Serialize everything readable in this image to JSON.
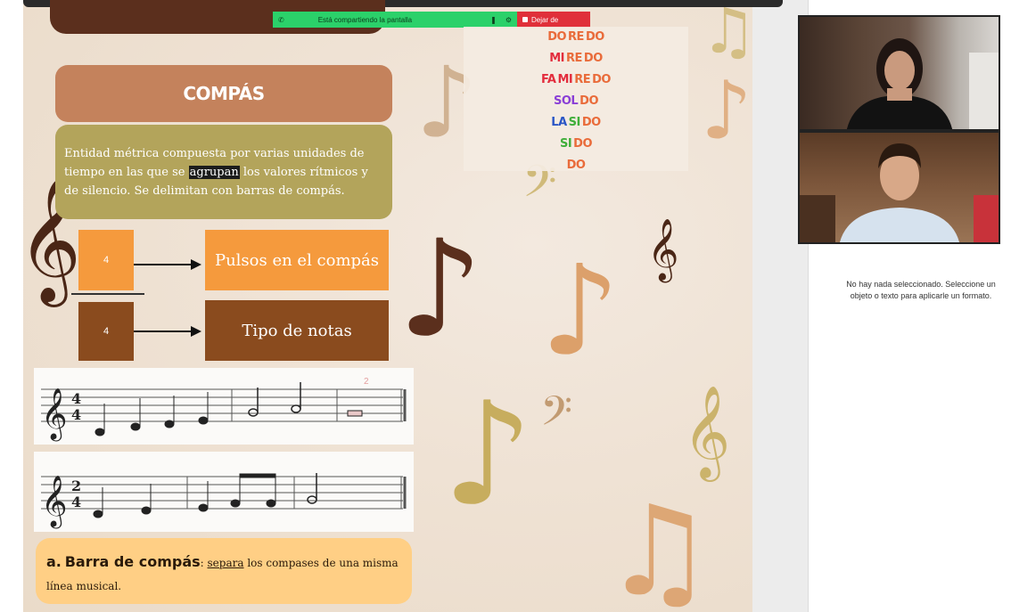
{
  "share_bar": {
    "sharing_label": "Está compartiendo la pantalla",
    "stop_label": "Dejar de"
  },
  "solfege_rows": [
    [
      {
        "t": "DO",
        "c": "#e96b3a"
      },
      {
        "t": "RE",
        "c": "#e96b3a"
      },
      {
        "t": "DO",
        "c": "#e96b3a"
      }
    ],
    [
      {
        "t": "MI",
        "c": "#e32d3d"
      },
      {
        "t": "RE",
        "c": "#e96b3a"
      },
      {
        "t": "DO",
        "c": "#e96b3a"
      }
    ],
    [
      {
        "t": "FA",
        "c": "#e32d3d"
      },
      {
        "t": "MI",
        "c": "#e32d3d"
      },
      {
        "t": "RE",
        "c": "#e96b3a"
      },
      {
        "t": "DO",
        "c": "#e96b3a"
      }
    ],
    [
      {
        "t": "SOL",
        "c": "#8a3fd6"
      },
      {
        "t": "DO",
        "c": "#e96b3a"
      }
    ],
    [
      {
        "t": "LA",
        "c": "#2a56c6"
      },
      {
        "t": "SI",
        "c": "#3fae3a"
      },
      {
        "t": "DO",
        "c": "#e96b3a"
      }
    ],
    [
      {
        "t": "SI",
        "c": "#3fae3a"
      },
      {
        "t": "DO",
        "c": "#e96b3a"
      }
    ],
    [
      {
        "t": "DO",
        "c": "#e96b3a"
      }
    ]
  ],
  "compas": {
    "title": "COMPÁS",
    "def_before": "Entidad métrica compuesta por varias unidades de tiempo en las que se ",
    "def_highlight": "agrupan",
    "def_after": " los valores rítmicos y de silencio. Se delimitan con barras de compás."
  },
  "time_signature": {
    "top_number": "4",
    "bottom_number": "4",
    "top_label": "Pulsos en el compás",
    "bottom_label": "Tipo de notas"
  },
  "staff_1": {
    "time_top": "4",
    "time_bottom": "4",
    "small_mark": "2"
  },
  "staff_2": {
    "time_top": "2",
    "time_bottom": "4"
  },
  "barra": {
    "bullet": "a.",
    "title": "Barra de compás",
    "colon": ":",
    "verb": "separa",
    "text": " los compases de una misma línea musical."
  },
  "right_panel": {
    "hint": "No hay nada seleccionado. Seleccione un objeto o texto para aplicarle un formato."
  },
  "colors": {
    "slide_title_bg": "#c4825c",
    "definition_bg": "#b3a45b",
    "orange": "#f59a3d",
    "brown": "#8a4b1e",
    "barra_bg": "#ffcf85",
    "share_green": "#2bd16a",
    "share_red": "#e0303a"
  }
}
